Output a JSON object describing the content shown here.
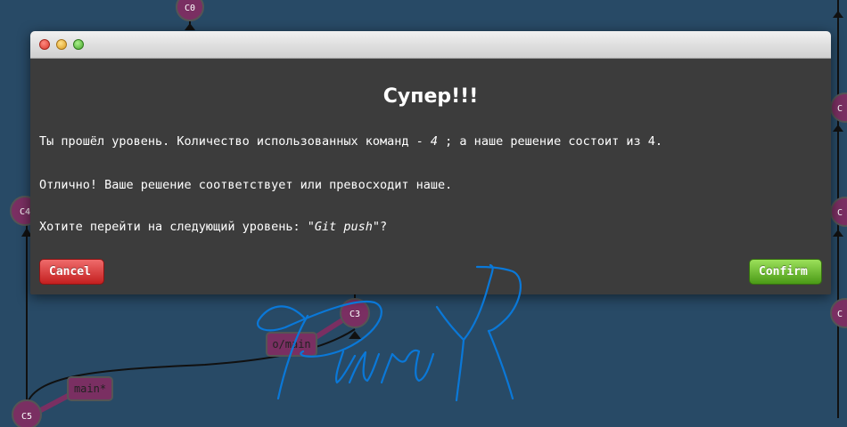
{
  "graph": {
    "nodes": [
      {
        "id": "c0_top",
        "label": "C0"
      },
      {
        "id": "c_left",
        "label": "C4"
      },
      {
        "id": "c3",
        "label": "C3"
      },
      {
        "id": "c5",
        "label": "C5"
      },
      {
        "id": "r1",
        "label": "C"
      },
      {
        "id": "r2",
        "label": "C"
      },
      {
        "id": "r3",
        "label": "C"
      }
    ],
    "branches": [
      {
        "id": "o_main",
        "label": "o/main"
      },
      {
        "id": "main",
        "label": "main*"
      }
    ],
    "colors": {
      "background": "#284a66",
      "node": "#7a2f62",
      "branch_label_bg": "#7a2f62",
      "line": "#111111"
    }
  },
  "dialog": {
    "title": "Супер!!!",
    "line1_prefix": "Ты прошёл уровень. Количество использованных команд - ",
    "line1_count": "4",
    "line1_suffix": " ; а наше решение состоит из 4.",
    "line2": "Отлично! Ваше решение соответствует или превосходит наше.",
    "line3_prefix": "Хотите перейти на следующий уровень: ",
    "line3_level": "\"Git push\"",
    "line3_suffix": "?",
    "cancel_label": "Cancel",
    "confirm_label": "Confirm",
    "colors": {
      "cancel": "#d63a3a",
      "confirm": "#6fbe2e",
      "window_bg": "#3c3c3c"
    }
  },
  "signature": {
    "color": "#0a78d8"
  }
}
